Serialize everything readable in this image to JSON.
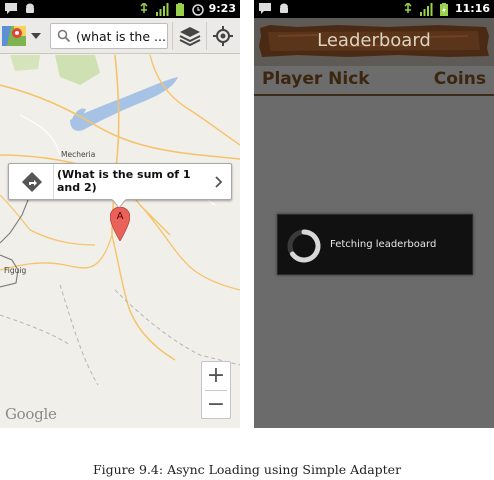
{
  "map_screen": {
    "status_time": "9:23",
    "search_text": "(what is the ...",
    "balloon_text": "(What is the sum of 1 and 2)",
    "pin_label": "A",
    "place_labels": [
      "Mecheria",
      "Figuig"
    ],
    "zoom_in": "+",
    "zoom_out": "−",
    "watermark": "Google"
  },
  "leaderboard_screen": {
    "status_time": "11:16",
    "title": "Leaderboard",
    "column_left": "Player Nick",
    "column_right": "Coins",
    "progress_message": "Fetching leaderboard"
  },
  "caption": "Figure 9.4: Async Loading using Simple Adapter",
  "colors": {
    "map_background": "#f1efe9",
    "road": "#f6c36a",
    "water": "#a6c3e6",
    "pin": "#e8625a",
    "leaderboard_background": "#6b6b6b",
    "leaderboard_header_text": "#3c2610",
    "dialog_background": "#111111"
  }
}
